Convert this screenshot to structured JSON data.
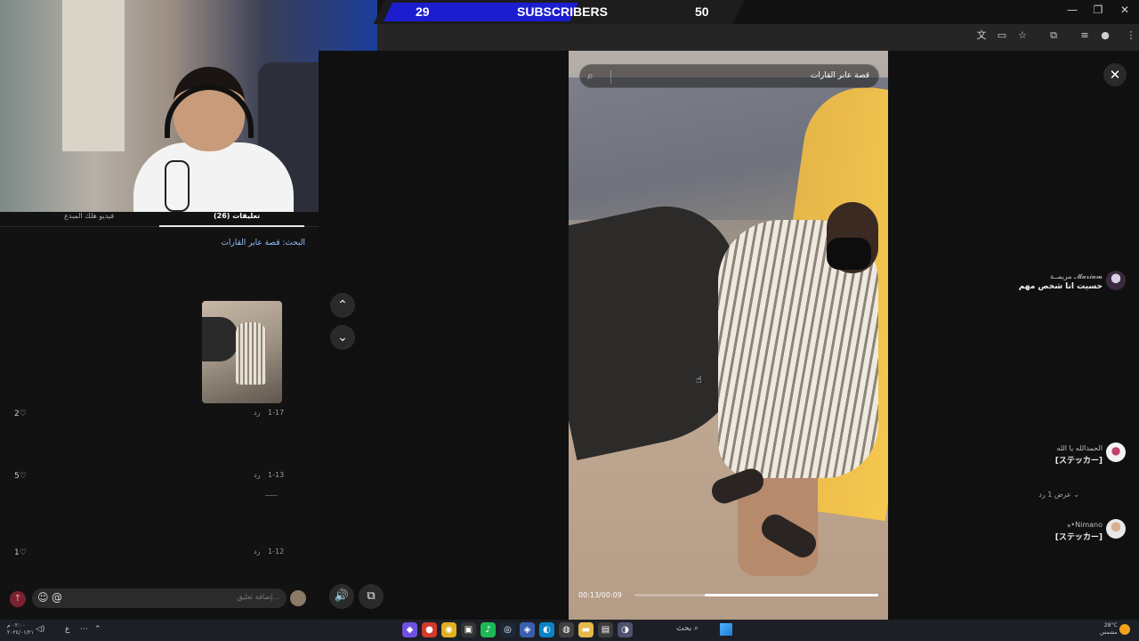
{
  "stream_overlay": {
    "subscribers_current": "29",
    "subscribers_label": "SUBSCRIBERS",
    "subscribers_goal": "50",
    "progress_fraction": 0.58,
    "bar_color": "#1d1dd0"
  },
  "window_controls": {
    "minimize": "—",
    "restore": "❐",
    "close": "✕"
  },
  "browser_toolbar_icons": [
    "translate-icon",
    "cast-icon",
    "star-icon",
    "extensions-icon",
    "tab-search-icon",
    "profile-icon",
    "menu-icon"
  ],
  "comments_panel": {
    "tabs": [
      {
        "label": "فيديو هلك المبدع",
        "active": false
      },
      {
        "label": "(26) تعليقات",
        "active": true
      }
    ],
    "search_label": "البحث: قصة عابر القارات",
    "comments": [
      {
        "name": "𝓜𝓪𝓻𝓲𝓪𝓶 مريمــة",
        "text": "حسيت انا شخص مهم",
        "date": "1-17",
        "reply": "رد",
        "likes": "2",
        "has_image": true
      },
      {
        "name": "الحمدالله يا الله",
        "text": "[ステッカー]",
        "date": "1-13",
        "reply": "رد",
        "likes": "5",
        "has_image": false,
        "replies_label": "عرض 1 رد"
      },
      {
        "name": "Nimano•ه",
        "text": "[ステッカー]",
        "date": "1-12",
        "reply": "رد",
        "likes": "1",
        "has_image": false
      }
    ],
    "comment_input_placeholder": "إضافة تعليق...",
    "emoji_icon": "☺",
    "mention_icon": "@",
    "send_icon": "↑"
  },
  "viewer": {
    "search_text": "قصة عابر القارات",
    "time_label": "00:13/00:09",
    "progress_fraction": 0.29,
    "nav_up": "⌃",
    "nav_down": "⌄",
    "volume_icon": "🔊",
    "pip_icon": "⧉",
    "close_icon": "✕"
  },
  "taskbar": {
    "clock": "٠٢:٠٠ م",
    "date": "٢٠٢٤/٠١/٢١",
    "lang": "ع",
    "search_label": "بحث",
    "weather_temp": "28°C",
    "weather_desc": "مشمس"
  }
}
